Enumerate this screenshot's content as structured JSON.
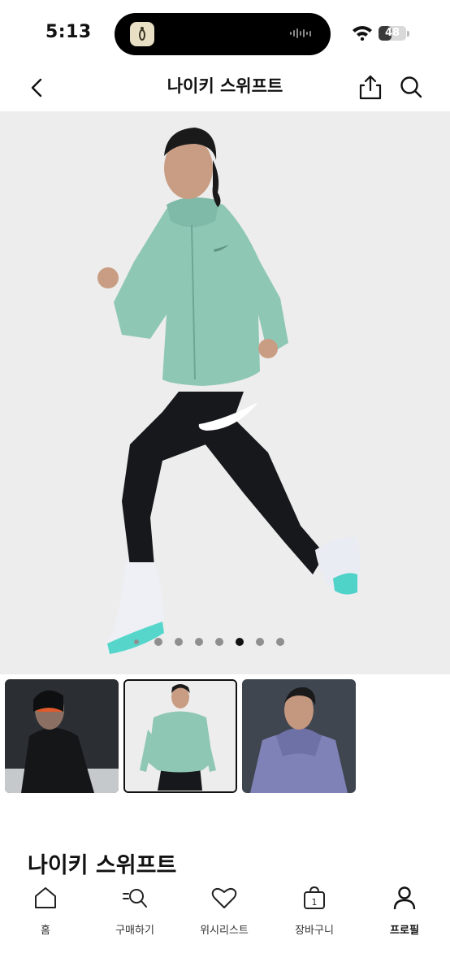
{
  "status_bar": {
    "time": "5:13",
    "battery": "48",
    "battery_level": 0.48
  },
  "header": {
    "title": "나이키 스위프트",
    "back_icon": "chevron-left-icon",
    "share_icon": "share-icon",
    "search_icon": "search-icon"
  },
  "gallery": {
    "image_count": 8,
    "active_index": 5,
    "thumbnails": [
      {
        "name": "black-jacket",
        "selected": false
      },
      {
        "name": "mint-jacket",
        "selected": true
      },
      {
        "name": "lavender-jacket",
        "selected": false
      }
    ]
  },
  "product": {
    "name": "나이키 스위프트"
  },
  "colors": {
    "accent": "#111111",
    "jacket_mint": "#8fc7b5",
    "jacket_black": "#1a1c1f",
    "jacket_lavender": "#7f82b6"
  },
  "tabbar": {
    "items": [
      {
        "label": "홈",
        "icon": "home-icon",
        "active": false
      },
      {
        "label": "구매하기",
        "icon": "shop-search-icon",
        "active": false
      },
      {
        "label": "위시리스트",
        "icon": "heart-icon",
        "active": false
      },
      {
        "label": "장바구니",
        "icon": "bag-icon",
        "badge": "1",
        "active": false
      },
      {
        "label": "프로필",
        "icon": "profile-icon",
        "active": true
      }
    ]
  }
}
